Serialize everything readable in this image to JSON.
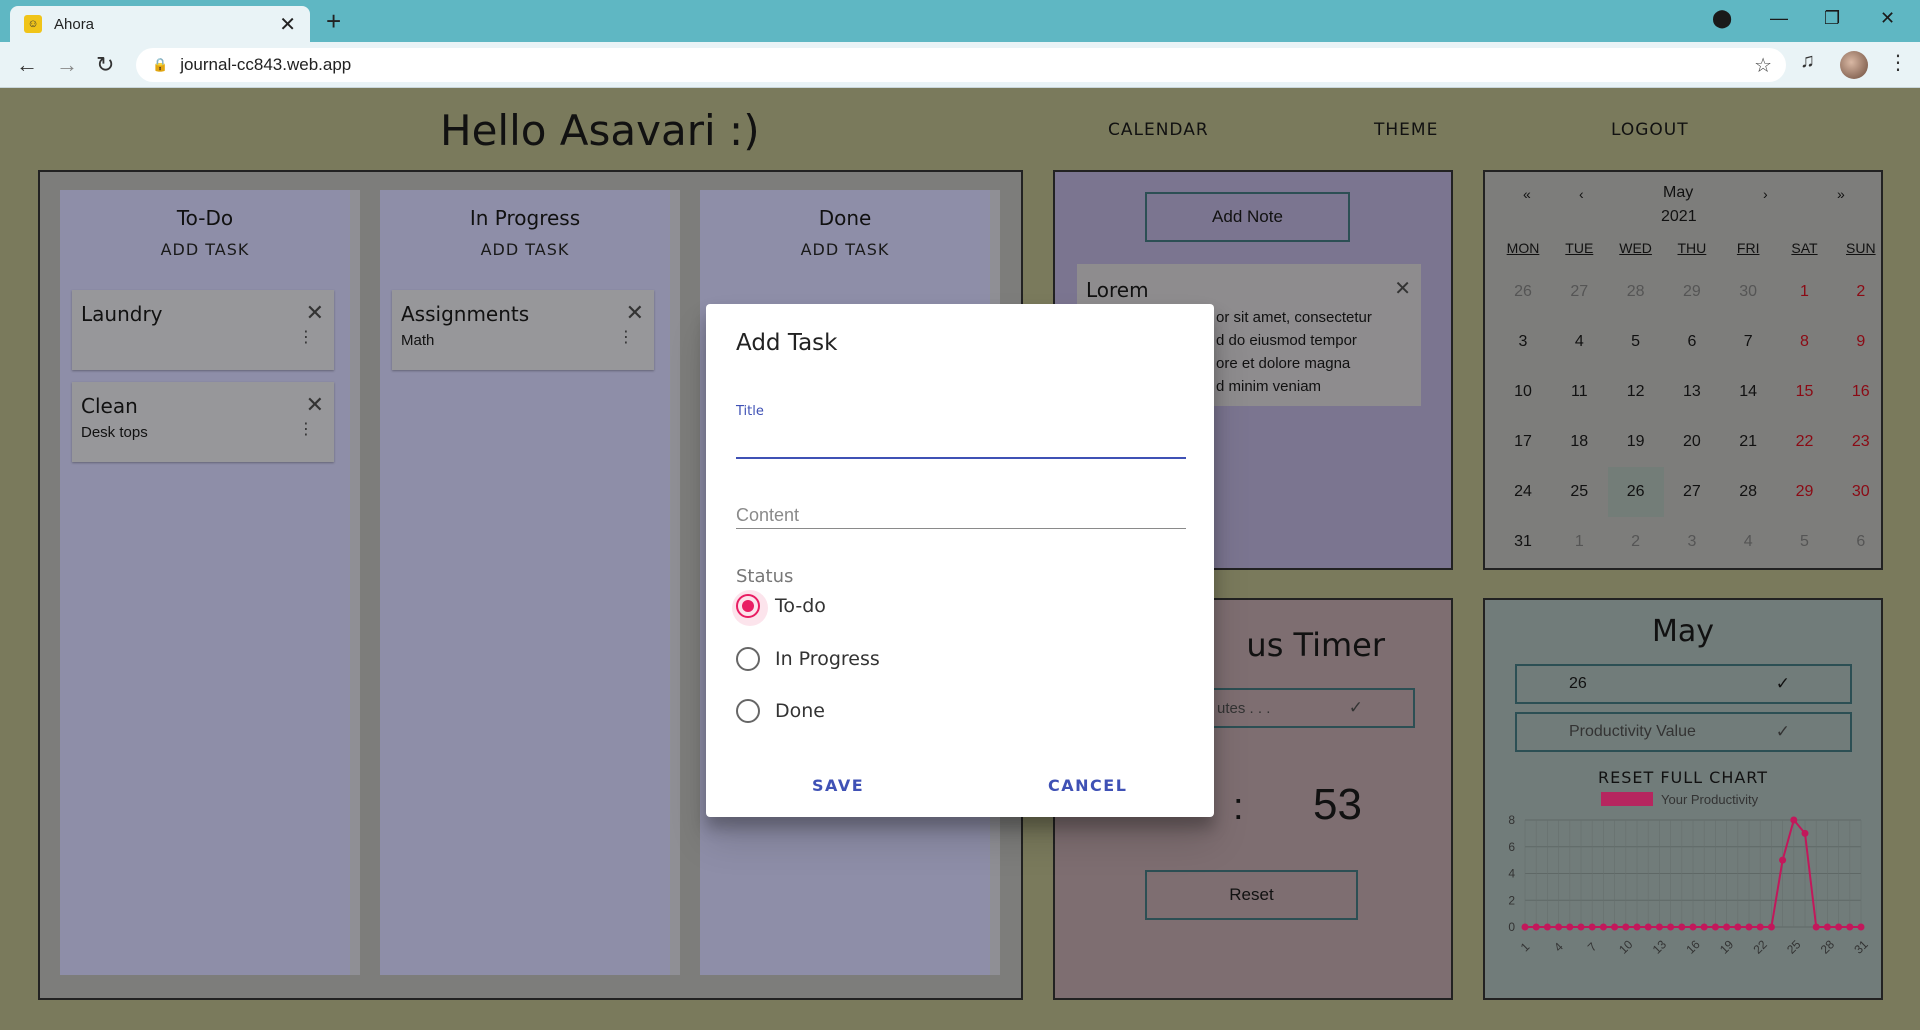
{
  "browser": {
    "tab_title": "Ahora",
    "tab_close": "✕",
    "new_tab": "+",
    "url": "journal-cc843.web.app",
    "icons": [
      "back-icon",
      "forward-icon",
      "reload-icon",
      "lock-icon",
      "star-icon",
      "media-icon",
      "menu-icon"
    ]
  },
  "app": {
    "greeting": "Hello Asavari :)",
    "nav": [
      "CALENDAR",
      "THEME",
      "LOGOUT"
    ]
  },
  "board": {
    "columns": [
      {
        "title": "To-Do",
        "add": "ADD TASK",
        "cards": [
          {
            "title": "Laundry",
            "sub": ""
          },
          {
            "title": "Clean",
            "sub": "Desk tops"
          }
        ]
      },
      {
        "title": "In Progress",
        "add": "ADD TASK",
        "cards": [
          {
            "title": "Assignments",
            "sub": "Math"
          }
        ]
      },
      {
        "title": "Done",
        "add": "ADD TASK",
        "cards": []
      }
    ]
  },
  "notes": {
    "add_label": "Add Note",
    "note_title": "Lorem",
    "note_lines": [
      "or sit amet, consectetur",
      "d do eiusmod tempor",
      "ore et dolore magna",
      "d minim veniam"
    ]
  },
  "calendar": {
    "month": "May",
    "year": "2021",
    "prev_year": "«",
    "prev_month": "‹",
    "next_month": "›",
    "next_year": "»",
    "weekdays": [
      "MON",
      "TUE",
      "WED",
      "THU",
      "FRI",
      "SAT",
      "SUN"
    ],
    "weeks": [
      [
        "26",
        "27",
        "28",
        "29",
        "30",
        "1",
        "2"
      ],
      [
        "3",
        "4",
        "5",
        "6",
        "7",
        "8",
        "9"
      ],
      [
        "10",
        "11",
        "12",
        "13",
        "14",
        "15",
        "16"
      ],
      [
        "17",
        "18",
        "19",
        "20",
        "21",
        "22",
        "23"
      ],
      [
        "24",
        "25",
        "26",
        "27",
        "28",
        "29",
        "30"
      ],
      [
        "31",
        "1",
        "2",
        "3",
        "4",
        "5",
        "6"
      ]
    ],
    "today": "26"
  },
  "timer": {
    "title": "us Timer",
    "input_placeholder": "utes . . .",
    "check": "✓",
    "colon": ":",
    "seconds": "53",
    "reset": "Reset"
  },
  "productivity": {
    "month": "May",
    "day_value": "26",
    "value_placeholder": "Productivity Value",
    "check": "✓",
    "reset_label": "RESET FULL CHART"
  },
  "chart_data": {
    "type": "line",
    "legend": "Your Productivity",
    "x": [
      1,
      2,
      3,
      4,
      5,
      6,
      7,
      8,
      9,
      10,
      11,
      12,
      13,
      14,
      15,
      16,
      17,
      18,
      19,
      20,
      21,
      22,
      23,
      24,
      25,
      26,
      27,
      28,
      29,
      30,
      31
    ],
    "xticks": [
      "1",
      "4",
      "7",
      "10",
      "13",
      "16",
      "19",
      "22",
      "25",
      "28",
      "31"
    ],
    "y": [
      0,
      0,
      0,
      0,
      0,
      0,
      0,
      0,
      0,
      0,
      0,
      0,
      0,
      0,
      0,
      0,
      0,
      0,
      0,
      0,
      0,
      0,
      0,
      5,
      8,
      7,
      0,
      0,
      0,
      0,
      0
    ],
    "ylim": [
      0,
      8
    ],
    "yticks": [
      "0",
      "2",
      "4",
      "6",
      "8"
    ],
    "color": "#c2185b",
    "grid": true
  },
  "dialog": {
    "title": "Add Task",
    "title_label": "Title",
    "content_placeholder": "Content",
    "status_label": "Status",
    "options": [
      "To-do",
      "In Progress",
      "Done"
    ],
    "selected": "To-do",
    "save": "SAVE",
    "cancel": "CANCEL",
    "accent": "#3f51b5",
    "radio_color": "#e91e63"
  }
}
